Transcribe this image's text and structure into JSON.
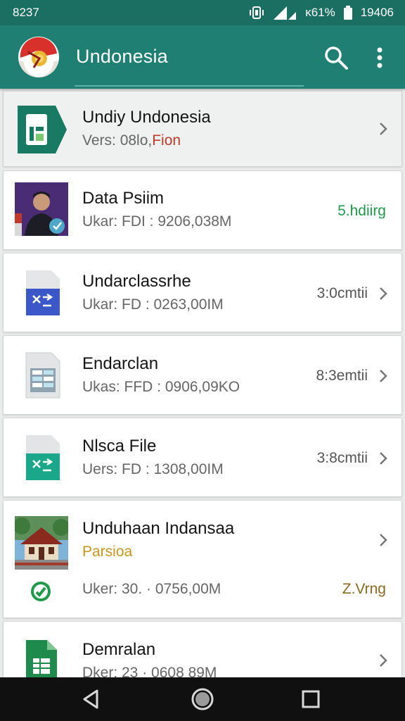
{
  "status_bar": {
    "time": "8237",
    "indicators": "ᴋ61%",
    "clock": "19406",
    "icons": [
      "vibrate-icon",
      "signal-icon",
      "battery-icon"
    ]
  },
  "app_bar": {
    "title": "Undonesia",
    "icons": [
      "search-icon",
      "overflow-menu-icon"
    ]
  },
  "items": [
    {
      "title": "Undiy Undonesia",
      "sub_prefix": "Vers: 08lo,",
      "sub_highlight": "Fion",
      "meta": "",
      "icon": "sheets-app-icon"
    },
    {
      "title": "Data Psiim",
      "sub": "Ukar: FDI : 9206,038M",
      "meta": "5.hdiirg",
      "icon": "person-photo-icon"
    },
    {
      "title": "Undarclassrhe",
      "sub": "Ukar: FD : 0263,00IM",
      "meta": "3:0cmtii",
      "icon": "file-blue-icon"
    },
    {
      "title": "Endarclan",
      "sub": "Ukas: FFD : 0906,09KO",
      "meta": "8:3emtii",
      "icon": "file-grey-icon"
    },
    {
      "title": "Nlsca File",
      "sub": "Uers: FD : 1308,00IM",
      "meta": "3:8cmtii",
      "icon": "file-green-icon"
    },
    {
      "title": "Unduhaan  Indansaa",
      "sub": "Parsioa",
      "sub2": "Uker: 30. · 0756,00M",
      "meta": "Z.Vrng",
      "icon": "house-photo-icon",
      "status_icon": "sync-check-icon"
    },
    {
      "title": "Demralan",
      "sub": "Dker: 23 · 0608 89M",
      "meta": "",
      "icon": "spreadsheet-icon"
    }
  ],
  "colors": {
    "status_bar": "#1a6e62",
    "app_bar": "#1f7f72",
    "accent_green": "#1f9a4a",
    "accent_red": "#c0392b",
    "accent_gold": "#c8961d"
  },
  "nav_bar": {
    "buttons": [
      "back-icon",
      "home-icon",
      "recents-icon"
    ]
  }
}
